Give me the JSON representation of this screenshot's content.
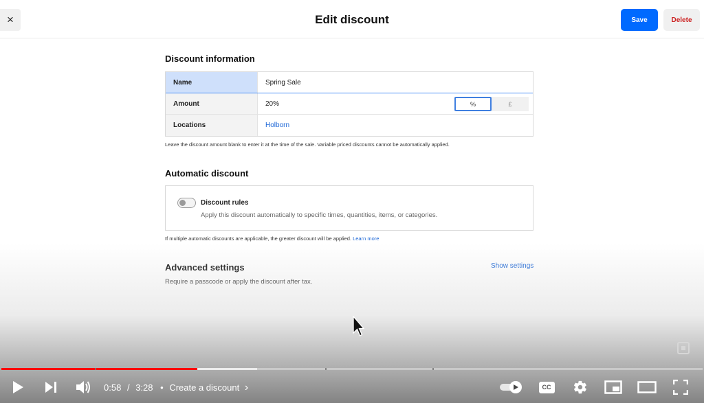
{
  "header": {
    "title": "Edit discount",
    "close_label": "×",
    "save_label": "Save",
    "delete_label": "Delete"
  },
  "discount_information": {
    "section_title": "Discount information",
    "rows": [
      {
        "label": "Name",
        "value": "Spring Sale"
      },
      {
        "label": "Amount",
        "value": "20%"
      },
      {
        "label": "Locations",
        "value": "Holborn"
      }
    ],
    "unit_percent": "%",
    "unit_currency": "£",
    "help_text": "Leave the discount amount blank to enter it at the time of the sale. Variable priced discounts cannot be automatically applied."
  },
  "automatic_discount": {
    "section_title": "Automatic discount",
    "toggle_label": "Discount rules",
    "toggle_on": false,
    "toggle_description": "Apply this discount automatically to specific times, quantities, items, or categories.",
    "help_text": "If multiple automatic discounts are applicable, the greater discount will be applied.",
    "learn_more": "Learn more"
  },
  "advanced_settings": {
    "section_title": "Advanced settings",
    "show_settings": "Show settings",
    "description": "Require a passcode or apply the discount after tax."
  },
  "video_player": {
    "current_time": "0:58",
    "duration": "3:28",
    "separator": "/",
    "bullet": "•",
    "chapter_title": "Create a discount",
    "chapter_arrow": "›",
    "played_fraction": 0.279,
    "buffered_fraction": 0.365,
    "chapter_breaks": [
      0.133,
      0.462,
      0.615
    ],
    "autoplay_on": true,
    "controls": [
      "play-icon",
      "next-icon",
      "volume-icon",
      "autoplay-toggle",
      "captions-icon",
      "settings-gear-icon",
      "miniplayer-icon",
      "theater-mode-icon",
      "fullscreen-icon"
    ],
    "captions_label": "CC",
    "colors": {
      "played": "#ff0000",
      "accent_button": "#006aff",
      "delete_text": "#cc1f1f",
      "link": "#1a65d6"
    }
  }
}
